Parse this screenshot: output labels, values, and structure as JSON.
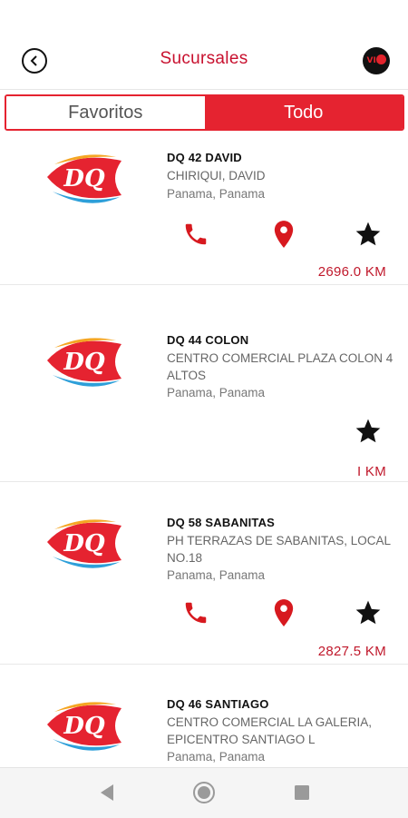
{
  "header": {
    "title": "Sucursales",
    "badge_text": "VIP"
  },
  "tabs": [
    {
      "label": "Favoritos"
    },
    {
      "label": "Todo"
    }
  ],
  "stores": [
    {
      "name": "DQ 42  DAVID",
      "address": "CHIRIQUI, DAVID",
      "city": "Panama, Panama",
      "distance": "2696.0 KM"
    },
    {
      "name": "DQ 44 COLON",
      "address": "CENTRO COMERCIAL PLAZA COLON 4 ALTOS",
      "city": "Panama, Panama",
      "distance": "I KM"
    },
    {
      "name": "DQ 58 SABANITAS",
      "address": "PH TERRAZAS DE SABANITAS, LOCAL NO.18",
      "city": "Panama, Panama",
      "distance": "2827.5 KM"
    },
    {
      "name": "DQ 46 SANTIAGO",
      "address": "CENTRO COMERCIAL LA GALERIA, EPICENTRO  SANTIAGO L",
      "city": "Panama, Panama",
      "distance": ""
    }
  ],
  "colors": {
    "brand_red": "#e52330",
    "title_red": "#c8102e"
  }
}
